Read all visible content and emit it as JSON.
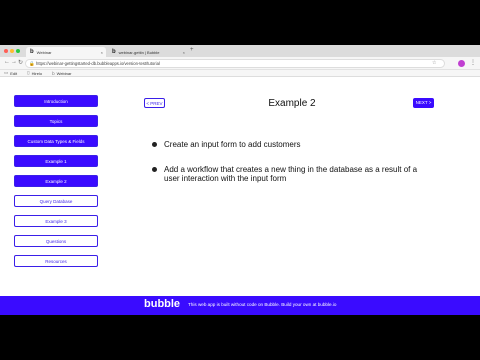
{
  "browser": {
    "tabs": [
      {
        "label": "Webinar",
        "active": true
      },
      {
        "label": "webinar-gettin | Bubble",
        "active": false
      }
    ],
    "new_tab": "+",
    "url": "https://webinar-gettingstarted-db.bubbleapps.io/version-test/tutorial",
    "bookmarks": [
      {
        "label": "Edit",
        "icon": "folder-icon"
      },
      {
        "label": "Hirelo",
        "icon": "page-icon"
      },
      {
        "label": "Webinar",
        "icon": "bubble-icon"
      }
    ]
  },
  "sidebar": {
    "items": [
      {
        "label": "Introduction",
        "style": "filled"
      },
      {
        "label": "Topics",
        "style": "filled"
      },
      {
        "label": "Custom Data Types & Fields",
        "style": "filled"
      },
      {
        "label": "Example 1",
        "style": "filled"
      },
      {
        "label": "Example 2",
        "style": "filled"
      },
      {
        "label": "Query Database",
        "style": "outline"
      },
      {
        "label": "Example 3",
        "style": "outline"
      },
      {
        "label": "Questions",
        "style": "outline"
      },
      {
        "label": "Resources",
        "style": "outline"
      }
    ]
  },
  "main": {
    "prev_label": "< PREV",
    "title": "Example 2",
    "next_label": "NEXT >",
    "bullets": [
      "Create an input form to add customers",
      "Add a workflow that creates a new thing in the database as a result of a user interaction with the input form"
    ]
  },
  "footer": {
    "brand": "bubble",
    "message": "This web app is built without code on Bubble. Build your own at bubble.io"
  },
  "colors": {
    "accent": "#3a0bff",
    "traffic_red": "#ff5f57",
    "traffic_yellow": "#febc2e",
    "traffic_green": "#28c840"
  }
}
